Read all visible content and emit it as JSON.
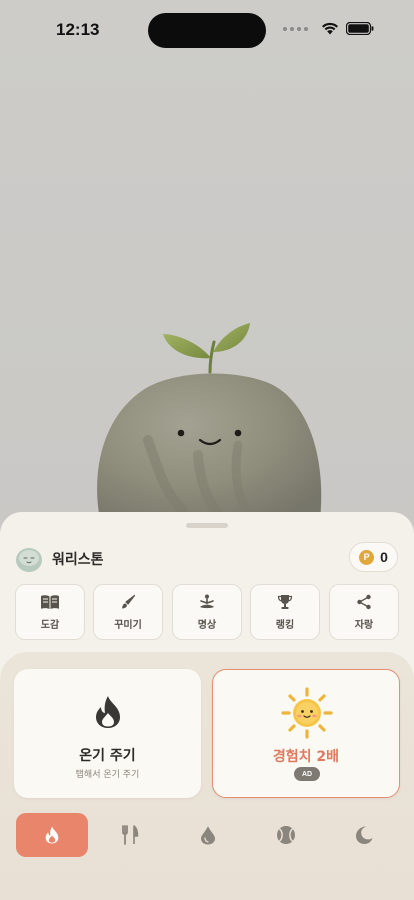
{
  "status_bar": {
    "time": "12:13"
  },
  "pet": {
    "name": "워리스톤"
  },
  "points": {
    "badge": "P",
    "value": "0"
  },
  "menu": [
    {
      "label": "도감",
      "icon": "book-icon"
    },
    {
      "label": "꾸미기",
      "icon": "brush-icon"
    },
    {
      "label": "명상",
      "icon": "meditation-icon"
    },
    {
      "label": "랭킹",
      "icon": "trophy-icon"
    },
    {
      "label": "자랑",
      "icon": "share-icon"
    }
  ],
  "actions": {
    "warm": {
      "title": "온기 주기",
      "subtitle": "탭해서 온기 주기",
      "icon": "flame-icon"
    },
    "xp": {
      "title": "경험치 2배",
      "badge": "AD",
      "icon": "sun-icon"
    }
  },
  "tabs": [
    {
      "name": "warmth",
      "icon": "flame-icon",
      "active": true
    },
    {
      "name": "food",
      "icon": "fork-knife-icon",
      "active": false
    },
    {
      "name": "water",
      "icon": "water-drop-icon",
      "active": false
    },
    {
      "name": "play",
      "icon": "ball-icon",
      "active": false
    },
    {
      "name": "sleep",
      "icon": "moon-icon",
      "active": false
    }
  ],
  "colors": {
    "accent": "#e8856a",
    "xp_text": "#e07a5f",
    "coin": "#e0a73b",
    "sheet": "#f4f1ea",
    "background": "#cdccc9"
  }
}
